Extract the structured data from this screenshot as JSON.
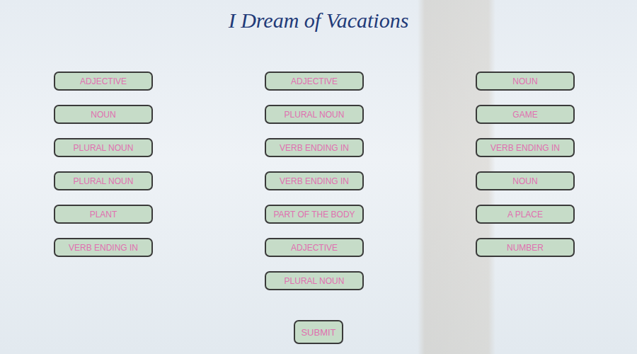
{
  "title": "I Dream of Vacations",
  "columns": [
    {
      "fields": [
        {
          "placeholder": "ADJECTIVE"
        },
        {
          "placeholder": "NOUN"
        },
        {
          "placeholder": "PLURAL NOUN"
        },
        {
          "placeholder": "PLURAL NOUN"
        },
        {
          "placeholder": "PLANT"
        },
        {
          "placeholder": "VERB ENDING IN"
        }
      ]
    },
    {
      "fields": [
        {
          "placeholder": "ADJECTIVE"
        },
        {
          "placeholder": "PLURAL NOUN"
        },
        {
          "placeholder": "VERB ENDING IN"
        },
        {
          "placeholder": "VERB ENDING IN"
        },
        {
          "placeholder": "PART OF THE BODY"
        },
        {
          "placeholder": "ADJECTIVE"
        },
        {
          "placeholder": "PLURAL NOUN"
        }
      ]
    },
    {
      "fields": [
        {
          "placeholder": "NOUN"
        },
        {
          "placeholder": "GAME"
        },
        {
          "placeholder": "VERB ENDING IN"
        },
        {
          "placeholder": "NOUN"
        },
        {
          "placeholder": "A PLACE"
        },
        {
          "placeholder": "NUMBER"
        }
      ]
    }
  ],
  "submit": {
    "label": "SUBMIT"
  }
}
